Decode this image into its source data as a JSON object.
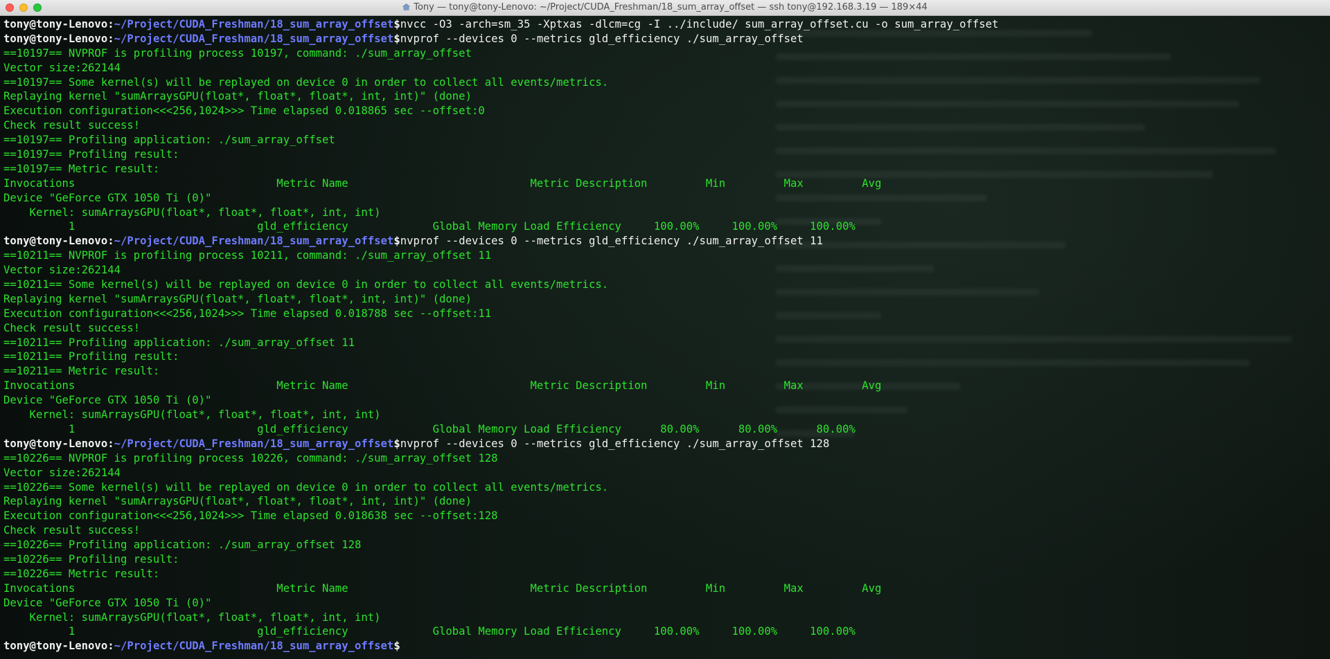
{
  "window": {
    "title": "Tony — tony@tony-Lenovo: ~/Project/CUDA_Freshman/18_sum_array_offset — ssh tony@192.168.3.19 — 189×44"
  },
  "prompt": {
    "user": "tony@tony-Lenovo",
    "sep": ":",
    "path": "~/Project/CUDA_Freshman/18_sum_array_offset",
    "suffix": "$ "
  },
  "lines": [
    {
      "type": "prompt",
      "cmd": "nvcc -O3 -arch=sm_35 -Xptxas -dlcm=cg -I ../include/ sum_array_offset.cu -o sum_array_offset"
    },
    {
      "type": "prompt",
      "cmd": "nvprof --devices 0 --metrics gld_efficiency ./sum_array_offset"
    },
    {
      "type": "out",
      "text": "==10197== NVPROF is profiling process 10197, command: ./sum_array_offset"
    },
    {
      "type": "out",
      "text": "Vector size:262144"
    },
    {
      "type": "out",
      "text": "==10197== Some kernel(s) will be replayed on device 0 in order to collect all events/metrics."
    },
    {
      "type": "out",
      "text": "Replaying kernel \"sumArraysGPU(float*, float*, float*, int, int)\" (done)"
    },
    {
      "type": "out",
      "text": "Execution configuration<<<256,1024>>> Time elapsed 0.018865 sec --offset:0"
    },
    {
      "type": "out",
      "text": "Check result success!"
    },
    {
      "type": "out",
      "text": "==10197== Profiling application: ./sum_array_offset"
    },
    {
      "type": "out",
      "text": "==10197== Profiling result:"
    },
    {
      "type": "out",
      "text": "==10197== Metric result:"
    },
    {
      "type": "out",
      "text": "Invocations                               Metric Name                            Metric Description         Min         Max         Avg"
    },
    {
      "type": "out",
      "text": "Device \"GeForce GTX 1050 Ti (0)\""
    },
    {
      "type": "out",
      "text": "    Kernel: sumArraysGPU(float*, float*, float*, int, int)"
    },
    {
      "type": "out",
      "text": "          1                            gld_efficiency             Global Memory Load Efficiency     100.00%     100.00%     100.00%"
    },
    {
      "type": "prompt",
      "cmd": "nvprof --devices 0 --metrics gld_efficiency ./sum_array_offset 11"
    },
    {
      "type": "out",
      "text": "==10211== NVPROF is profiling process 10211, command: ./sum_array_offset 11"
    },
    {
      "type": "out",
      "text": "Vector size:262144"
    },
    {
      "type": "out",
      "text": "==10211== Some kernel(s) will be replayed on device 0 in order to collect all events/metrics."
    },
    {
      "type": "out",
      "text": "Replaying kernel \"sumArraysGPU(float*, float*, float*, int, int)\" (done)"
    },
    {
      "type": "out",
      "text": "Execution configuration<<<256,1024>>> Time elapsed 0.018788 sec --offset:11"
    },
    {
      "type": "out",
      "text": "Check result success!"
    },
    {
      "type": "out",
      "text": "==10211== Profiling application: ./sum_array_offset 11"
    },
    {
      "type": "out",
      "text": "==10211== Profiling result:"
    },
    {
      "type": "out",
      "text": "==10211== Metric result:"
    },
    {
      "type": "out",
      "text": "Invocations                               Metric Name                            Metric Description         Min         Max         Avg"
    },
    {
      "type": "out",
      "text": "Device \"GeForce GTX 1050 Ti (0)\""
    },
    {
      "type": "out",
      "text": "    Kernel: sumArraysGPU(float*, float*, float*, int, int)"
    },
    {
      "type": "out",
      "text": "          1                            gld_efficiency             Global Memory Load Efficiency      80.00%      80.00%      80.00%"
    },
    {
      "type": "prompt",
      "cmd": "nvprof --devices 0 --metrics gld_efficiency ./sum_array_offset 128"
    },
    {
      "type": "out",
      "text": "==10226== NVPROF is profiling process 10226, command: ./sum_array_offset 128"
    },
    {
      "type": "out",
      "text": "Vector size:262144"
    },
    {
      "type": "out",
      "text": "==10226== Some kernel(s) will be replayed on device 0 in order to collect all events/metrics."
    },
    {
      "type": "out",
      "text": "Replaying kernel \"sumArraysGPU(float*, float*, float*, int, int)\" (done)"
    },
    {
      "type": "out",
      "text": "Execution configuration<<<256,1024>>> Time elapsed 0.018638 sec --offset:128"
    },
    {
      "type": "out",
      "text": "Check result success!"
    },
    {
      "type": "out",
      "text": "==10226== Profiling application: ./sum_array_offset 128"
    },
    {
      "type": "out",
      "text": "==10226== Profiling result:"
    },
    {
      "type": "out",
      "text": "==10226== Metric result:"
    },
    {
      "type": "out",
      "text": "Invocations                               Metric Name                            Metric Description         Min         Max         Avg"
    },
    {
      "type": "out",
      "text": "Device \"GeForce GTX 1050 Ti (0)\""
    },
    {
      "type": "out",
      "text": "    Kernel: sumArraysGPU(float*, float*, float*, int, int)"
    },
    {
      "type": "out",
      "text": "          1                            gld_efficiency             Global Memory Load Efficiency     100.00%     100.00%     100.00%"
    },
    {
      "type": "prompt",
      "cmd": ""
    }
  ],
  "colors": {
    "output": "#2ee22e",
    "user": "#f2f2f2",
    "path": "#6e7bff"
  },
  "icons": {
    "title": "home-folder-icon"
  }
}
